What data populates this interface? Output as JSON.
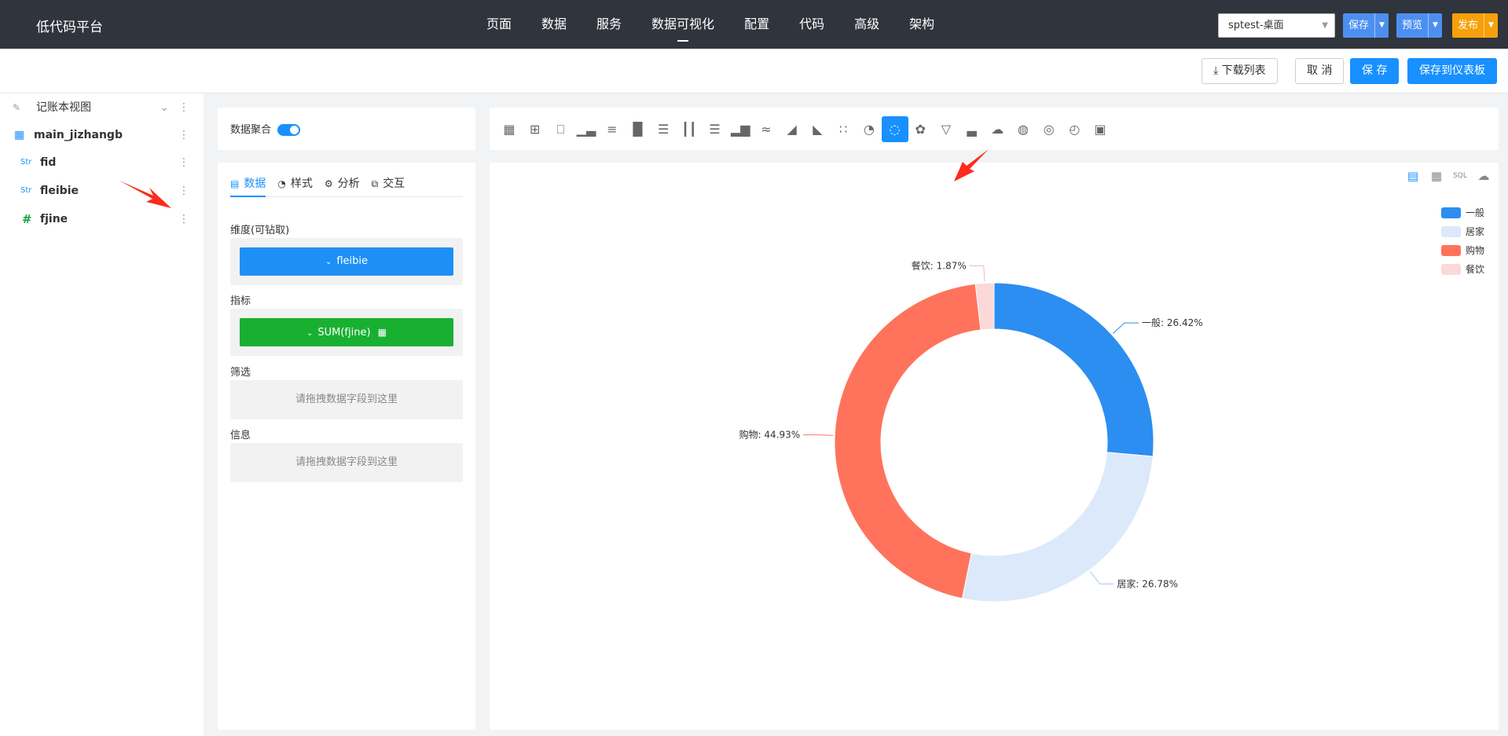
{
  "app": {
    "brand": "低代码平台"
  },
  "nav": [
    {
      "label": "页面",
      "active": false
    },
    {
      "label": "数据",
      "active": false
    },
    {
      "label": "服务",
      "active": false
    },
    {
      "label": "数据可视化",
      "active": true
    },
    {
      "label": "配置",
      "active": false
    },
    {
      "label": "代码",
      "active": false
    },
    {
      "label": "高级",
      "active": false
    },
    {
      "label": "架构",
      "active": false
    }
  ],
  "topbar": {
    "app_select": "sptest-桌面",
    "save_label": "保存",
    "preview_label": "预览",
    "publish_label": "发布"
  },
  "actions": {
    "download_list": "下载列表",
    "cancel": "取 消",
    "save": "保 存",
    "save_dashboard": "保存到仪表板"
  },
  "tree": {
    "view_name": "记账本视图",
    "table_name": "main_jizhangb",
    "fields": [
      {
        "type": "Str",
        "name": "fid"
      },
      {
        "type": "Str",
        "name": "fleibie"
      },
      {
        "type": "#",
        "name": "fjine"
      }
    ]
  },
  "config": {
    "aggregate_label": "数据聚合",
    "tabs": [
      {
        "icon": "data-icon",
        "label": "数据",
        "active": true
      },
      {
        "icon": "style-icon",
        "label": "样式",
        "active": false
      },
      {
        "icon": "analysis-icon",
        "label": "分析",
        "active": false
      },
      {
        "icon": "interact-icon",
        "label": "交互",
        "active": false
      }
    ],
    "dimension_label": "维度(可钻取)",
    "dimension_value": "fleibie",
    "metric_label": "指标",
    "metric_value": "SUM(fjine)",
    "filter_label": "筛选",
    "filter_placeholder": "请拖拽数据字段到这里",
    "info_label": "信息",
    "info_placeholder": "请拖拽数据字段到这里"
  },
  "chart_toolbar": {
    "icons": [
      "table-icon",
      "pivot-table-icon",
      "number-card-icon",
      "column-chart-icon",
      "bar-chart-icon",
      "grouped-column-icon",
      "grouped-bar-icon",
      "stacked-column-icon",
      "stacked-bar-icon",
      "combo-column-icon",
      "line-chart-icon",
      "area-chart-icon",
      "stacked-area-icon",
      "scatter-icon",
      "pie-chart-icon",
      "donut-chart-icon",
      "rose-chart-icon",
      "funnel-icon",
      "bar-line-icon",
      "word-cloud-icon",
      "map-icon",
      "globe-icon",
      "gauge-icon",
      "text-card-icon"
    ],
    "active_index": 15
  },
  "chart_data": {
    "type": "pie",
    "variant": "donut",
    "categories": [
      "一般",
      "居家",
      "购物",
      "餐饮"
    ],
    "values": [
      26.42,
      26.78,
      44.93,
      1.87
    ],
    "labels": [
      "一般: 26.42%",
      "居家: 26.78%",
      "购物: 44.93%",
      "餐饮: 1.87%"
    ],
    "colors": [
      "#2b8ef0",
      "#dbe9fb",
      "#ff735c",
      "#fbd9d9"
    ],
    "legend_position": "top-right",
    "start_angle": "12 o'clock, clockwise"
  }
}
